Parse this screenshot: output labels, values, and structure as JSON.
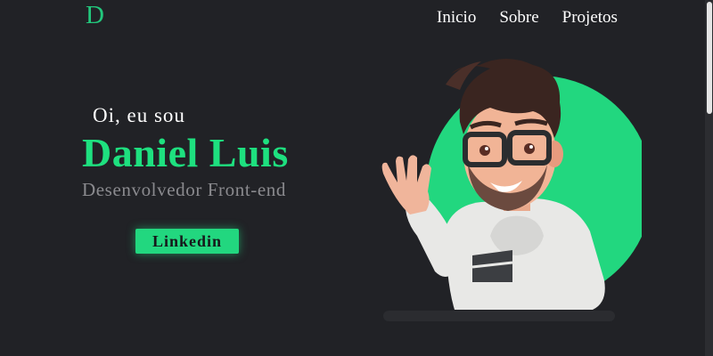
{
  "header": {
    "logo": "D",
    "nav": [
      {
        "label": "Inicio"
      },
      {
        "label": "Sobre"
      },
      {
        "label": "Projetos"
      }
    ]
  },
  "hero": {
    "greeting": "Oi, eu sou",
    "name": "Daniel Luis",
    "role": "Desenvolvedor Front-end",
    "cta_label": "Linkedin",
    "avatar_icon": "avatar-illustration"
  },
  "colors": {
    "background": "#212226",
    "accent": "#22d77f",
    "text": "#ffffff",
    "muted": "#8a8a8e"
  }
}
